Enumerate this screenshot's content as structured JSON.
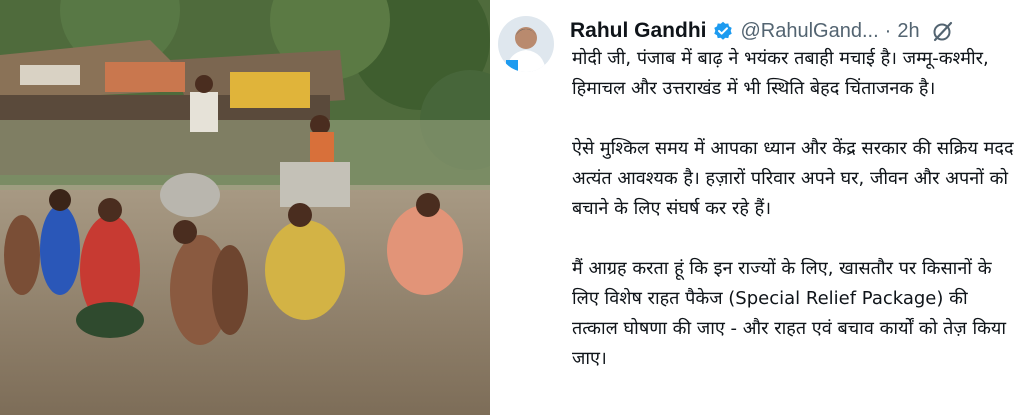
{
  "tweet": {
    "author_name": "Rahul Gandhi",
    "handle": "@RahulGand...",
    "separator": "·",
    "time": "2h",
    "verified_icon": "verified-badge-icon",
    "grok_icon": "grok-icon",
    "paragraphs": [
      "मोदी जी, पंजाब में बाढ़ ने भयंकर तबाही मचाई है। जम्मू-कश्मीर, हिमाचल और उत्तराखंड में भी स्थिति बेहद चिंताजनक है।",
      "ऐसे मुश्किल समय में आपका ध्यान और केंद्र सरकार की सक्रिय मदद अत्यंत आवश्यक है। हज़ारों परिवार अपने घर, जीवन और अपनों को बचाने के लिए संघर्ष कर रहे हैं।",
      "मैं आग्रह करता हूं कि इन राज्यों के लिए, खासतौर पर किसानों के लिए विशेष राहत पैकेज (Special Relief Package) की तत्काल घोषणा की जाए - और राहत एवं बचाव कार्यों को तेज़ किया जाए।"
    ]
  },
  "colors": {
    "verified_blue": "#1d9bf0",
    "text_primary": "#0f1419",
    "text_secondary": "#536471",
    "flood_water": "#8f7e68"
  }
}
